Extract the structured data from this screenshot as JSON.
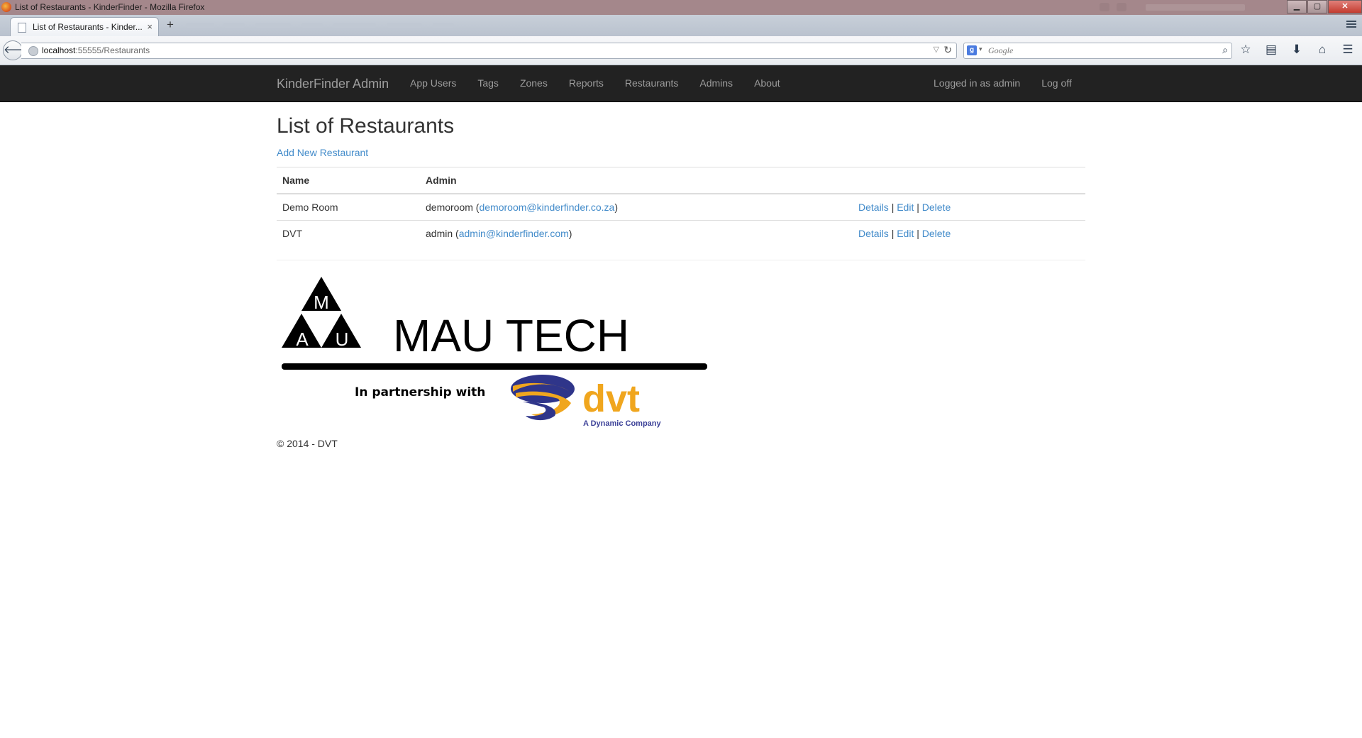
{
  "window": {
    "title": "List of Restaurants - KinderFinder - Mozilla Firefox",
    "min_label": "▁",
    "max_label": "▢",
    "close_label": "✕"
  },
  "tab": {
    "title": "List of Restaurants - Kinder...",
    "close": "×",
    "new_tab": "+"
  },
  "urlbar": {
    "host": "localhost",
    "tail": ":55555/Restaurants"
  },
  "search": {
    "engine_letter": "g",
    "placeholder": "Google"
  },
  "icons": [
    "back-icon",
    "globe-icon",
    "reload-icon",
    "search-engine-icon",
    "magnifier-icon",
    "bookmark-star-icon",
    "reading-list-icon",
    "download-icon",
    "home-icon",
    "menu-icon"
  ],
  "site": {
    "brand": "KinderFinder Admin",
    "menu": [
      "App Users",
      "Tags",
      "Zones",
      "Reports",
      "Restaurants",
      "Admins",
      "About"
    ],
    "user_status": "Logged in as admin",
    "logoff": "Log off"
  },
  "page": {
    "heading": "List of Restaurants",
    "add_link": "Add New Restaurant",
    "columns": [
      "Name",
      "Admin"
    ],
    "rows": [
      {
        "name": "Demo Room",
        "admin_user": "demoroom",
        "admin_email": "demoroom@kinderfinder.co.za"
      },
      {
        "name": "DVT",
        "admin_user": "admin",
        "admin_email": "admin@kinderfinder.com"
      }
    ],
    "actions": {
      "details": "Details",
      "edit": "Edit",
      "delete": "Delete",
      "sep": "|"
    }
  },
  "logo": {
    "letters": [
      "M",
      "A",
      "U"
    ],
    "company": "MAU TECH",
    "partnership": "In partnership with",
    "partner": "dvt",
    "partner_tagline": "A Dynamic Company"
  },
  "footer": "© 2014 - DVT",
  "colors": {
    "navbar_bg": "#222222",
    "nav_text": "#9d9d9d",
    "link": "#428bca",
    "dvt_blue": "#3a3f97",
    "dvt_orange": "#f0a61e"
  }
}
